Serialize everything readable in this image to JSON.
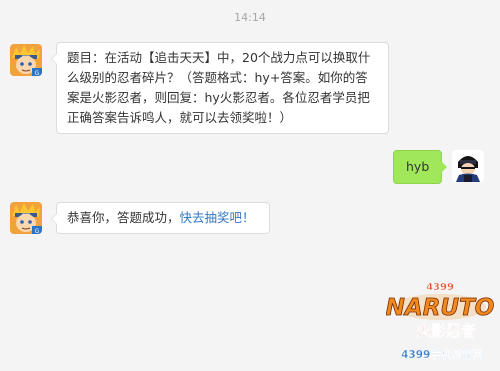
{
  "chat": {
    "timestamp": "14:14",
    "messages": [
      {
        "sender": "bot",
        "avatar_icon": "naruto-avatar-icon",
        "text": "题目：在活动【追击天天】中，20个战力点可以换取什么级别的忍者碎片？（答题格式：hy+答案。如你的答案是火影忍者，则回复：hy火影忍者。各位忍者学员把正确答案告诉鸣人，就可以去领奖啦！）"
      },
      {
        "sender": "user",
        "avatar_icon": "ninja-avatar-icon",
        "text": "hyb"
      },
      {
        "sender": "bot",
        "avatar_icon": "naruto-avatar-icon",
        "text": "恭喜你，答题成功，",
        "link": "快去抽奖吧！"
      }
    ]
  },
  "watermark": {
    "logo": "NARUTO",
    "number": "4399",
    "subtitle": "火影忍者",
    "site": "4399手机游戏网"
  },
  "colors": {
    "background": "#f4f4f4",
    "user_bubble": "#a0e75a",
    "link": "#2f78c4"
  }
}
